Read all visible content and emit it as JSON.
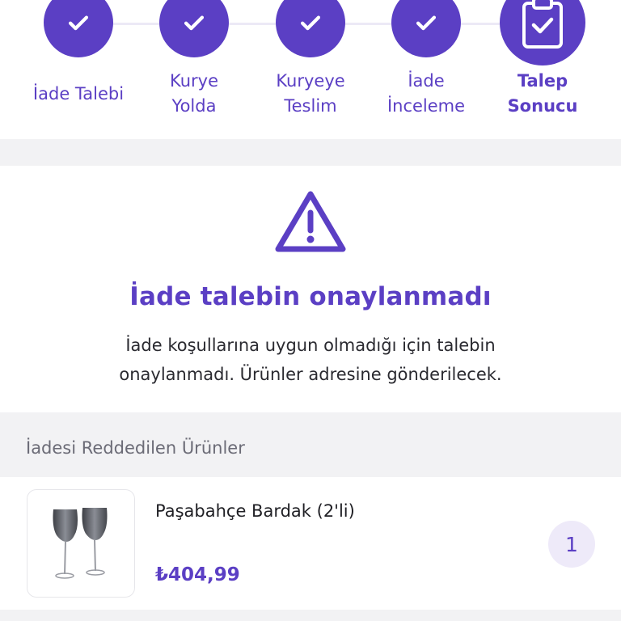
{
  "stepper": {
    "steps": [
      {
        "label_line1": "İade Talebi",
        "label_line2": "",
        "state": "done",
        "icon": "check-icon"
      },
      {
        "label_line1": "Kurye",
        "label_line2": "Yolda",
        "state": "done",
        "icon": "check-icon"
      },
      {
        "label_line1": "Kuryeye",
        "label_line2": "Teslim",
        "state": "done",
        "icon": "check-icon"
      },
      {
        "label_line1": "İade",
        "label_line2": "İnceleme",
        "state": "done",
        "icon": "check-icon"
      },
      {
        "label_line1": "Talep",
        "label_line2": "Sonucu",
        "state": "current",
        "icon": "clipboard-check-icon"
      }
    ]
  },
  "result": {
    "icon": "warning-triangle-icon",
    "title": "İade talebin onaylanmadı",
    "description": "İade koşullarına uygun olmadığı için talebin onaylanmadı. Ürünler adresine gönderilecek."
  },
  "rejected_section": {
    "title": "İadesi Reddedilen Ürünler"
  },
  "products": [
    {
      "name": "Paşabahçe Bardak (2'li)",
      "price": "₺404,99",
      "quantity": "1",
      "image_icon": "wine-glasses-icon"
    }
  ],
  "colors": {
    "accent": "#5b3fc4",
    "accent_light": "#eeeaf9",
    "background_gap": "#f2f2f4",
    "text_secondary": "#6b6b76"
  }
}
